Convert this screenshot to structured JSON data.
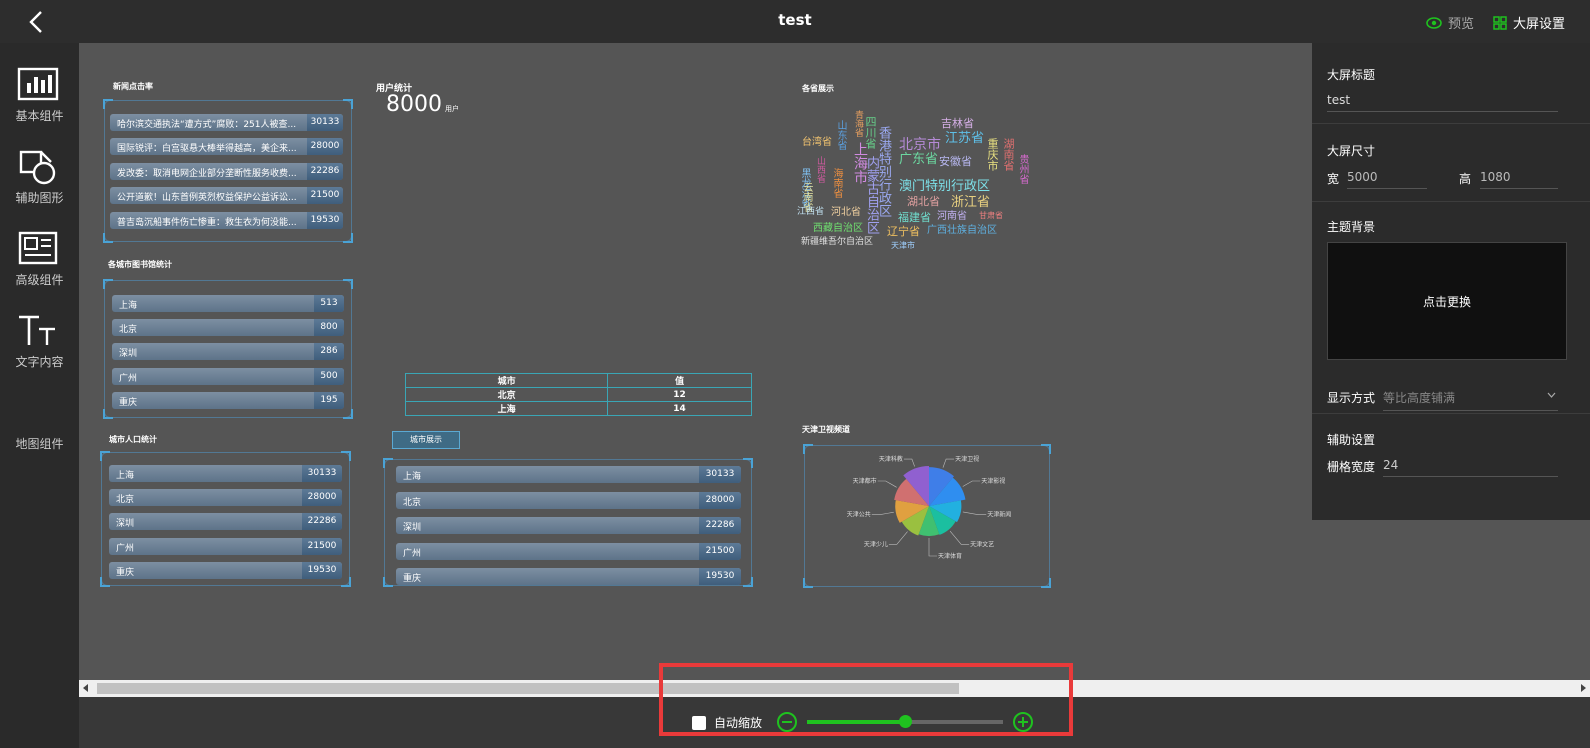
{
  "header": {
    "title": "test",
    "preview": "预览",
    "settings": "大屏设置"
  },
  "sidebar": {
    "items": [
      {
        "label": "基本组件",
        "icon": "bar-chart-icon"
      },
      {
        "label": "辅助图形",
        "icon": "shapes-icon"
      },
      {
        "label": "高级组件",
        "icon": "advanced-widget-icon"
      },
      {
        "label": "文字内容",
        "icon": "text-icon"
      },
      {
        "label": "地图组件",
        "icon": "map-icon"
      }
    ]
  },
  "panel": {
    "title_section": "大屏标题",
    "title_value": "test",
    "size_section": "大屏尺寸",
    "width_label": "宽",
    "width_value": "5000",
    "height_label": "高",
    "height_value": "1080",
    "bg_section": "主题背景",
    "bg_button": "点击更换",
    "display_label": "显示方式",
    "display_value": "等比高度铺满",
    "aux_section": "辅助设置",
    "grid_label": "栅格宽度",
    "grid_value": "24"
  },
  "bottom": {
    "auto_scale": "自动缩放",
    "zoom_level": 0.5
  },
  "colors": {
    "accent": "#1fc21f",
    "highlight": "#e93a3a",
    "frame": "#4aa3d6"
  },
  "widgets": {
    "news": {
      "title": "新闻点击率",
      "rows": [
        {
          "label": "哈尔滨交通执法“遭方式”腐败：251人被查...",
          "value": "30133"
        },
        {
          "label": "国际锐评：白宫驱悬大棒举得越高，美企来...",
          "value": "28000"
        },
        {
          "label": "发改委：取消电网企业部分垄断性服务收费...",
          "value": "22286"
        },
        {
          "label": "公开道歉！山东首例英烈权益保护公益诉讼...",
          "value": "21500"
        },
        {
          "label": "普吉岛沉船事件伤亡惨重：救生衣为何没能...",
          "value": "19530"
        }
      ]
    },
    "user": {
      "title": "用户统计",
      "value": "8000",
      "unit": "用户"
    },
    "provinces_title": "各省展示",
    "library": {
      "title": "各城市图书馆统计",
      "rows": [
        {
          "label": "上海",
          "value": "513"
        },
        {
          "label": "北京",
          "value": "800"
        },
        {
          "label": "深圳",
          "value": "286"
        },
        {
          "label": "广州",
          "value": "500"
        },
        {
          "label": "重庆",
          "value": "195"
        }
      ]
    },
    "population": {
      "title": "城市人口统计",
      "rows": [
        {
          "label": "上海",
          "value": "30133"
        },
        {
          "label": "北京",
          "value": "28000"
        },
        {
          "label": "深圳",
          "value": "22286"
        },
        {
          "label": "广州",
          "value": "21500"
        },
        {
          "label": "重庆",
          "value": "19530"
        }
      ]
    },
    "city_show": {
      "tag": "城市展示",
      "rows": [
        {
          "label": "上海",
          "value": "30133"
        },
        {
          "label": "北京",
          "value": "28000"
        },
        {
          "label": "深圳",
          "value": "22286"
        },
        {
          "label": "广州",
          "value": "21500"
        },
        {
          "label": "重庆",
          "value": "19530"
        }
      ]
    },
    "table": {
      "headers": [
        "城市",
        "值"
      ],
      "rows": [
        [
          "北京",
          "12"
        ],
        [
          "上海",
          "14"
        ]
      ]
    },
    "tianjin": {
      "title": "天津卫视频道"
    }
  },
  "word_cloud": [
    {
      "t": "吉林省",
      "c": "#d7b0e8",
      "s": 11
    },
    {
      "t": "北京市",
      "c": "#b58ad6",
      "s": 14
    },
    {
      "t": "江苏省",
      "c": "#5ec0e8",
      "s": 13
    },
    {
      "t": "四川省",
      "c": "#66d08a",
      "s": 11
    },
    {
      "t": "青海省",
      "c": "#e8a060",
      "s": 9
    },
    {
      "t": "山东省",
      "c": "#5ba0e0",
      "s": 10
    },
    {
      "t": "台湾省",
      "c": "#f2c470",
      "s": 10
    },
    {
      "t": "上海市",
      "c": "#d08ae0",
      "s": 14
    },
    {
      "t": "香港特别行政区",
      "c": "#9aa8f0",
      "s": 13
    },
    {
      "t": "广东省",
      "c": "#6cd7a0",
      "s": 13
    },
    {
      "t": "安徽省",
      "c": "#b7b7f0",
      "s": 11
    },
    {
      "t": "重庆市",
      "c": "#e8e080",
      "s": 11
    },
    {
      "t": "湖南省",
      "c": "#e07070",
      "s": 11
    },
    {
      "t": "贵州省",
      "c": "#d76ad0",
      "s": 10
    },
    {
      "t": "山西省",
      "c": "#d05aa0",
      "s": 9
    },
    {
      "t": "内蒙古自治区",
      "c": "#a0a0f0",
      "s": 13
    },
    {
      "t": "黑龙江省",
      "c": "#80c0f0",
      "s": 10
    },
    {
      "t": "海南省",
      "c": "#f09040",
      "s": 10
    },
    {
      "t": "云南省",
      "c": "#e0e0a0",
      "s": 10
    },
    {
      "t": "澳门特别行政区",
      "c": "#7de0e8",
      "s": 13
    },
    {
      "t": "湖北省",
      "c": "#e0a0a0",
      "s": 11
    },
    {
      "t": "浙江省",
      "c": "#e8d080",
      "s": 13
    },
    {
      "t": "江西省",
      "c": "#c0e0f0",
      "s": 9
    },
    {
      "t": "河北省",
      "c": "#f0d0a0",
      "s": 10
    },
    {
      "t": "福建省",
      "c": "#70e0d0",
      "s": 11
    },
    {
      "t": "河南省",
      "c": "#c0b0f0",
      "s": 10
    },
    {
      "t": "甘肃省",
      "c": "#f08080",
      "s": 8
    },
    {
      "t": "广西壮族自治区",
      "c": "#5eb0e0",
      "s": 10
    },
    {
      "t": "西藏自治区",
      "c": "#70e070",
      "s": 10
    },
    {
      "t": "辽宁省",
      "c": "#f0c060",
      "s": 11
    },
    {
      "t": "新疆维吾尔自治区",
      "c": "#e0e0e0",
      "s": 9
    },
    {
      "t": "天津市",
      "c": "#a0d0ff",
      "s": 8
    }
  ],
  "chart_data": {
    "type": "pie",
    "title": "天津卫视频道",
    "categories": [
      "天津卫视",
      "天津影视",
      "天津新闻",
      "天津文艺",
      "天津体育",
      "天津少儿",
      "天津公共",
      "天津都市",
      "天津科教"
    ],
    "values": [
      90,
      82,
      62,
      55,
      52,
      58,
      68,
      75,
      95
    ],
    "colors": [
      "#3f7ee8",
      "#2f8ef0",
      "#22b0e0",
      "#1bbfa0",
      "#40c070",
      "#9ac040",
      "#e0a040",
      "#d07070",
      "#9060d0"
    ]
  }
}
